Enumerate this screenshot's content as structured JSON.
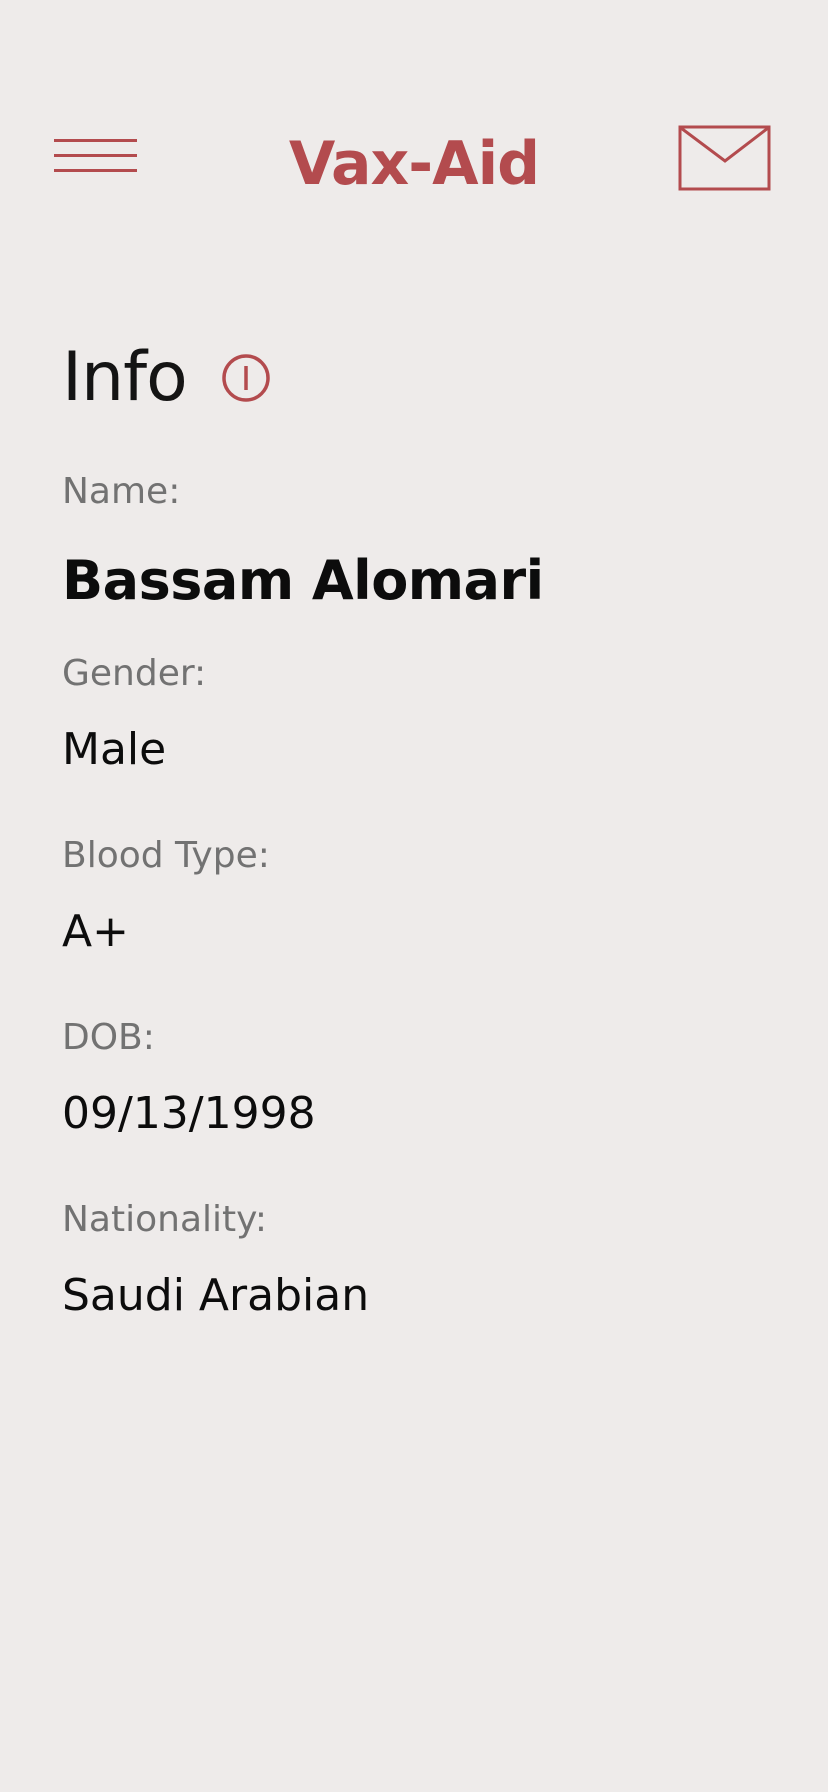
{
  "header": {
    "title": "Vax-Aid",
    "menu_icon": "hamburger-menu-icon",
    "mail_icon": "envelope-icon",
    "accent_color": "#b34b4e"
  },
  "info": {
    "title": "Info",
    "info_icon": "info-circle-icon",
    "fields": [
      {
        "label": "Name:",
        "value": "Bassam Alomari"
      },
      {
        "label": "Gender:",
        "value": "Male"
      },
      {
        "label": "Blood Type:",
        "value": "A+"
      },
      {
        "label": "DOB:",
        "value": "09/13/1998"
      },
      {
        "label": "Nationality:",
        "value": "Saudi Arabian"
      }
    ]
  }
}
